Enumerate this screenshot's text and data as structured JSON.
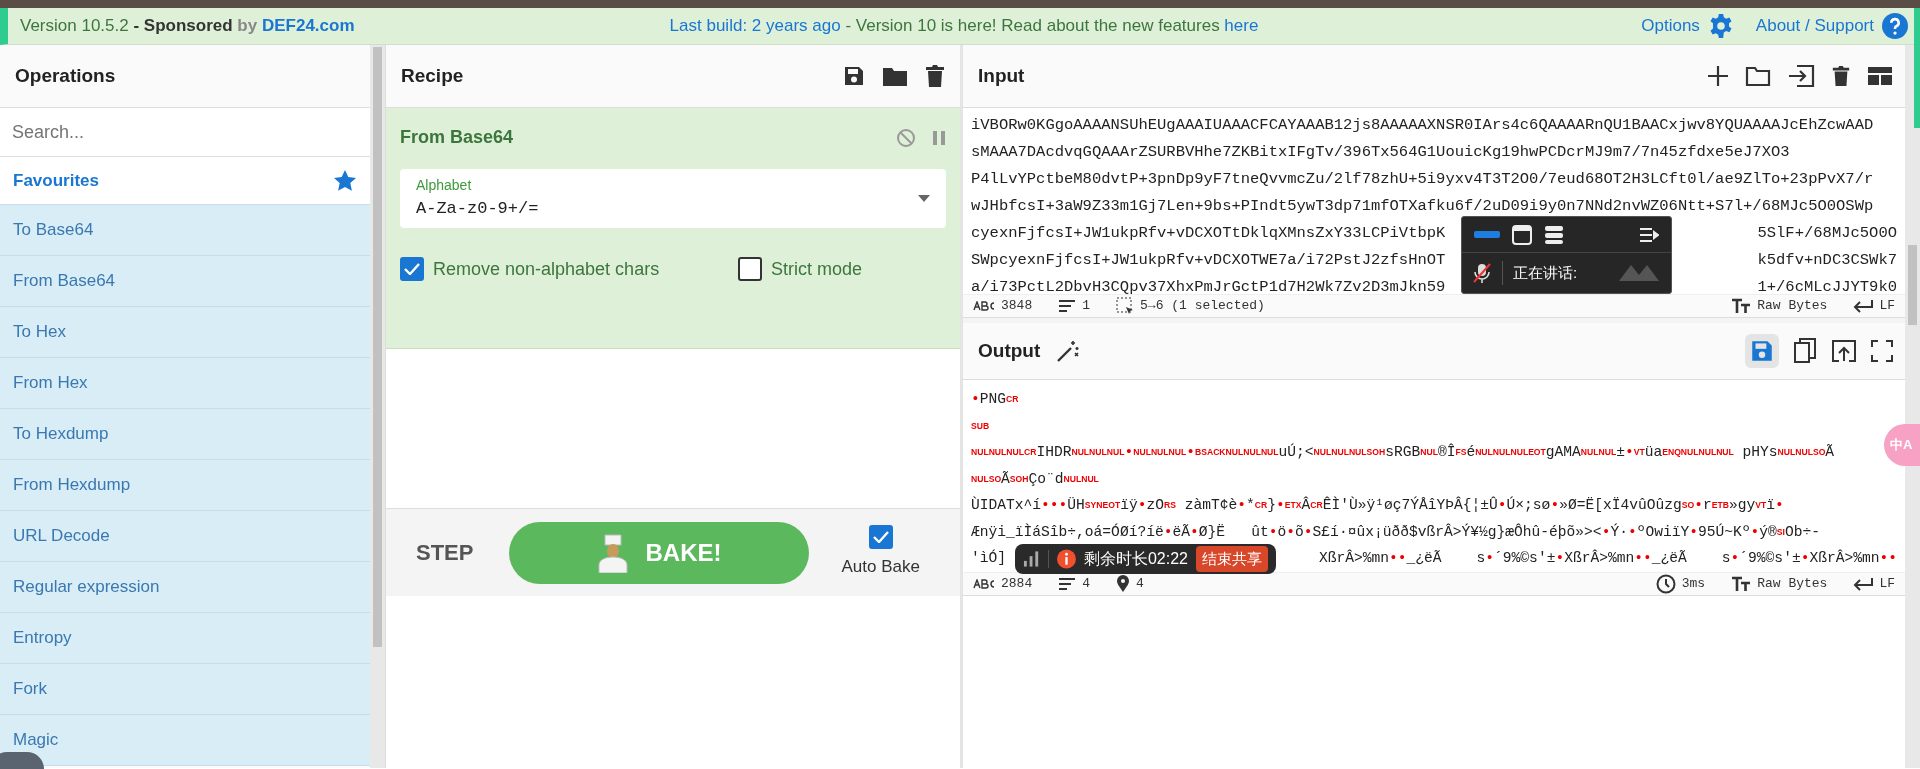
{
  "top_bar": {
    "version": "Version 10.5.2",
    "sponsored": "- Sponsored",
    "by": "by",
    "sponsor": "DEF24.com",
    "last_build": "Last build: 2 years ago",
    "announcement": " - Version 10 is here! Read about the new features ",
    "announcement_link": "here",
    "options": "Options",
    "about": "About / Support"
  },
  "operations": {
    "title": "Operations",
    "search": {
      "placeholder": "Search..."
    },
    "items": [
      {
        "label": "Favourites",
        "kind": "category"
      },
      {
        "label": "To Base64",
        "kind": "operation"
      },
      {
        "label": "From Base64",
        "kind": "operation"
      },
      {
        "label": "To Hex",
        "kind": "operation"
      },
      {
        "label": "From Hex",
        "kind": "operation"
      },
      {
        "label": "To Hexdump",
        "kind": "operation"
      },
      {
        "label": "From Hexdump",
        "kind": "operation"
      },
      {
        "label": "URL Decode",
        "kind": "operation"
      },
      {
        "label": "Regular expression",
        "kind": "operation"
      },
      {
        "label": "Entropy",
        "kind": "operation"
      },
      {
        "label": "Fork",
        "kind": "operation"
      },
      {
        "label": "Magic",
        "kind": "operation"
      }
    ]
  },
  "recipe": {
    "title": "Recipe",
    "step": {
      "name": "From Base64",
      "alphabet": {
        "label": "Alphabet",
        "value": "A-Za-z0-9+/="
      },
      "options": [
        {
          "label": "Remove non-alphabet chars",
          "checked": true
        },
        {
          "label": "Strict mode",
          "checked": false
        }
      ]
    },
    "controls": {
      "step": "STEP",
      "bake": "BAKE!",
      "auto_bake": {
        "label": "Auto Bake",
        "checked": true
      }
    }
  },
  "input": {
    "title": "Input",
    "lines": [
      {
        "head": "iVBORw0KGgoAAAANSUhEUgAAAIUAAACFCAYAAAB12js8AAAAAXNSR0IArs4c6QAAAARnQU1BAACxjwv8YQUAAAAJcEhZcwAAD"
      },
      {
        "head": "sMAAA7DAcdvqGQAAArZSURBVHhe7ZKBitxIFgTv/396Tx564G1UouicKg19hwPCDcrMJ9m7/7n45zfdxe5eJ7XO3"
      },
      {
        "head": "P4lLvYPctbeM80dvtP+3pnDp9yF7tneQvvmcZu/2lf78zhU+5i9yxv4T3T2O0/7eud68OT2H3LCft0l/ae9ZlTo+23pPvX7/r"
      },
      {
        "head": "wJHbfcsI+3aW9Z33m1Gj7Len+9bs+PIndt5ywT3dp71mfOTXafku6f/2uD09i9y0n7NNd2nvWZ06Ntt+S7l+/68MJc5O0OSWp"
      },
      {
        "head": "cyexnFjfcsI+JW1ukpRfv+vDCXOTtDklqXMnsZxY33LCPiVtbpK",
        "tail": "5SlF+/68MJc5O0O"
      },
      {
        "head": "SWpcyexnFjfcsI+JW1ukpRfv+vDCXOTWE7a/i72PstJ2zfsHnOT",
        "tail": "k5dfv+nDC3CSWk7"
      },
      {
        "head": "a/i73PctL2DbvH3CQpv37XhxPmJrGctP1d7H2Wk7Zv2D3mJkn59",
        "tail": "1+/6cMLcJJYT9k0"
      }
    ],
    "status": {
      "chars": "3848",
      "lines": "1",
      "selection": "5→6 (1 selected)",
      "encoding": "Raw Bytes",
      "eol": "LF"
    }
  },
  "output": {
    "title": "Output",
    "lines": [
      {
        "head": [
          {
            "kind": "mark",
            "text": "•"
          },
          {
            "kind": "plain",
            "text": "PNG"
          },
          {
            "kind": "ctrl",
            "text": "CR"
          }
        ]
      },
      {
        "head": [
          {
            "kind": "ctrl",
            "text": "SUB"
          }
        ]
      },
      {
        "head": [
          {
            "kind": "ctrl",
            "text": "NULNULNUL"
          },
          {
            "kind": "ctrl",
            "text": "CR"
          },
          {
            "kind": "plain",
            "text": "IHDR"
          },
          {
            "kind": "ctrl",
            "text": "NULNULNUL"
          },
          {
            "kind": "mark",
            "text": "•"
          },
          {
            "kind": "ctrl",
            "text": "NULNULNUL"
          },
          {
            "kind": "mark",
            "text": "•"
          },
          {
            "kind": "ctrl",
            "text": "BS"
          },
          {
            "kind": "ctrl",
            "text": "ACKNULNULNUL"
          },
          {
            "kind": "plain",
            "text": "uÚ;<"
          },
          {
            "kind": "ctrl",
            "text": "NULNULNULSOH"
          },
          {
            "kind": "plain",
            "text": "sRGB"
          },
          {
            "kind": "ctrl",
            "text": "NUL"
          },
          {
            "kind": "plain",
            "text": "®Î"
          },
          {
            "kind": "ctrl",
            "text": "FS"
          },
          {
            "kind": "plain",
            "text": "é"
          },
          {
            "kind": "ctrl",
            "text": "NULNULNULEOT"
          },
          {
            "kind": "plain",
            "text": "gAMA"
          },
          {
            "kind": "ctrl",
            "text": "NULNUL"
          },
          {
            "kind": "plain",
            "text": "±"
          },
          {
            "kind": "mark",
            "text": "•"
          },
          {
            "kind": "ctrl",
            "text": "VT"
          },
          {
            "kind": "plain",
            "text": "üa"
          },
          {
            "kind": "ctrl",
            "text": "ENQNULNULNUL"
          },
          {
            "kind": "plain",
            "text": " pHYs"
          },
          {
            "kind": "ctrl",
            "text": "NULNUL"
          },
          {
            "kind": "ctrl",
            "text": "SO"
          },
          {
            "kind": "plain",
            "text": "Ã"
          }
        ]
      },
      {
        "head": [
          {
            "kind": "ctrl",
            "text": "NUL"
          },
          {
            "kind": "ctrl",
            "text": "SO"
          },
          {
            "kind": "plain",
            "text": "Ã"
          },
          {
            "kind": "ctrl",
            "text": "SOH"
          },
          {
            "kind": "plain",
            "text": "Ço¨d"
          },
          {
            "kind": "ctrl",
            "text": "NULNUL"
          }
        ]
      },
      {
        "head": [
          {
            "kind": "plain",
            "text": "ÙIDATx^í"
          },
          {
            "kind": "mark",
            "text": "•••"
          },
          {
            "kind": "plain",
            "text": "ÜH"
          },
          {
            "kind": "ctrl",
            "text": "SYNEOT"
          },
          {
            "kind": "plain",
            "text": "ïÿ"
          },
          {
            "kind": "mark",
            "text": "•"
          },
          {
            "kind": "plain",
            "text": "zO"
          },
          {
            "kind": "ctrl",
            "text": "RS"
          },
          {
            "kind": "plain",
            "text": " zàmT¢è"
          },
          {
            "kind": "mark",
            "text": "•"
          },
          {
            "kind": "plain",
            "text": "*"
          },
          {
            "kind": "ctrl",
            "text": "CR"
          },
          {
            "kind": "plain",
            "text": "}"
          },
          {
            "kind": "mark",
            "text": "•"
          },
          {
            "kind": "ctrl",
            "text": "ETX"
          },
          {
            "kind": "plain",
            "text": "Â"
          },
          {
            "kind": "ctrl",
            "text": "CR"
          },
          {
            "kind": "plain",
            "text": "ÊÌ'Ù»ÿ¹øç7ÝÅîYÞÂ{¦±Û"
          },
          {
            "kind": "mark",
            "text": "•"
          },
          {
            "kind": "plain",
            "text": "Ú×;sø"
          },
          {
            "kind": "mark",
            "text": "•"
          },
          {
            "kind": "plain",
            "text": "»Ø=Ë[xÏ4vûOûzg"
          },
          {
            "kind": "ctrl",
            "text": "SO"
          },
          {
            "kind": "mark",
            "text": "•"
          },
          {
            "kind": "plain",
            "text": "r"
          },
          {
            "kind": "ctrl",
            "text": "ETB"
          },
          {
            "kind": "plain",
            "text": "»gy"
          },
          {
            "kind": "ctrl",
            "text": "VT"
          },
          {
            "kind": "plain",
            "text": "ï"
          },
          {
            "kind": "mark",
            "text": "•"
          }
        ]
      },
      {
        "head": [
          {
            "kind": "plain",
            "text": "Ænÿi_ïÌáSîb÷,oá=ÓØí?íë"
          },
          {
            "kind": "mark",
            "text": "•"
          },
          {
            "kind": "plain",
            "text": "ëÃ"
          },
          {
            "kind": "mark",
            "text": "•"
          },
          {
            "kind": "plain",
            "text": "Ø}Ë   ût"
          },
          {
            "kind": "mark",
            "text": "•"
          },
          {
            "kind": "plain",
            "text": "ö"
          },
          {
            "kind": "mark",
            "text": "•"
          },
          {
            "kind": "plain",
            "text": "õ"
          },
          {
            "kind": "mark",
            "text": "•"
          },
          {
            "kind": "plain",
            "text": "S£í·¤ûx¡üðð$vßrÂ>Ý¥½g}æÔhû-éþõ»><"
          },
          {
            "kind": "mark",
            "text": "•"
          },
          {
            "kind": "plain",
            "text": "Ý·"
          },
          {
            "kind": "mark",
            "text": "•"
          },
          {
            "kind": "plain",
            "text": "ºOwiïY"
          },
          {
            "kind": "mark",
            "text": "•"
          },
          {
            "kind": "plain",
            "text": "95Ú~Kº"
          },
          {
            "kind": "mark",
            "text": "•"
          },
          {
            "kind": "plain",
            "text": "ý®"
          },
          {
            "kind": "ctrl",
            "text": "SI"
          },
          {
            "kind": "plain",
            "text": "Ob÷-"
          }
        ]
      },
      {
        "head": [
          {
            "kind": "plain",
            "text": "'ìÓ]"
          }
        ],
        "tail": [
          {
            "kind": "plain",
            "text": "XßrÂ>%mn"
          },
          {
            "kind": "mark",
            "text": "••"
          },
          {
            "kind": "plain",
            "text": "_¿ëÃ    s"
          },
          {
            "kind": "mark",
            "text": "•"
          },
          {
            "kind": "plain",
            "text": "´9%©s'±"
          },
          {
            "kind": "mark",
            "text": "•"
          },
          {
            "kind": "plain",
            "text": "XßrÂ>%mn"
          },
          {
            "kind": "mark",
            "text": "••"
          },
          {
            "kind": "plain",
            "text": "_¿ëÃ    s"
          },
          {
            "kind": "mark",
            "text": "•"
          },
          {
            "kind": "plain",
            "text": "´9%©s'±"
          },
          {
            "kind": "mark",
            "text": "•"
          },
          {
            "kind": "plain",
            "text": "XßrÂ>%mn"
          },
          {
            "kind": "mark",
            "text": "••"
          }
        ]
      }
    ],
    "status": {
      "chars": "2884",
      "lines": "4",
      "markers": "4",
      "time": "3ms",
      "encoding": "Raw Bytes",
      "eol": "LF"
    }
  },
  "meeting_widget": {
    "speaking": "正在讲话:"
  },
  "share_bar": {
    "remaining": "剩余时长02:22",
    "stop": "结束共享"
  },
  "translate_button": {
    "label": "中A"
  }
}
